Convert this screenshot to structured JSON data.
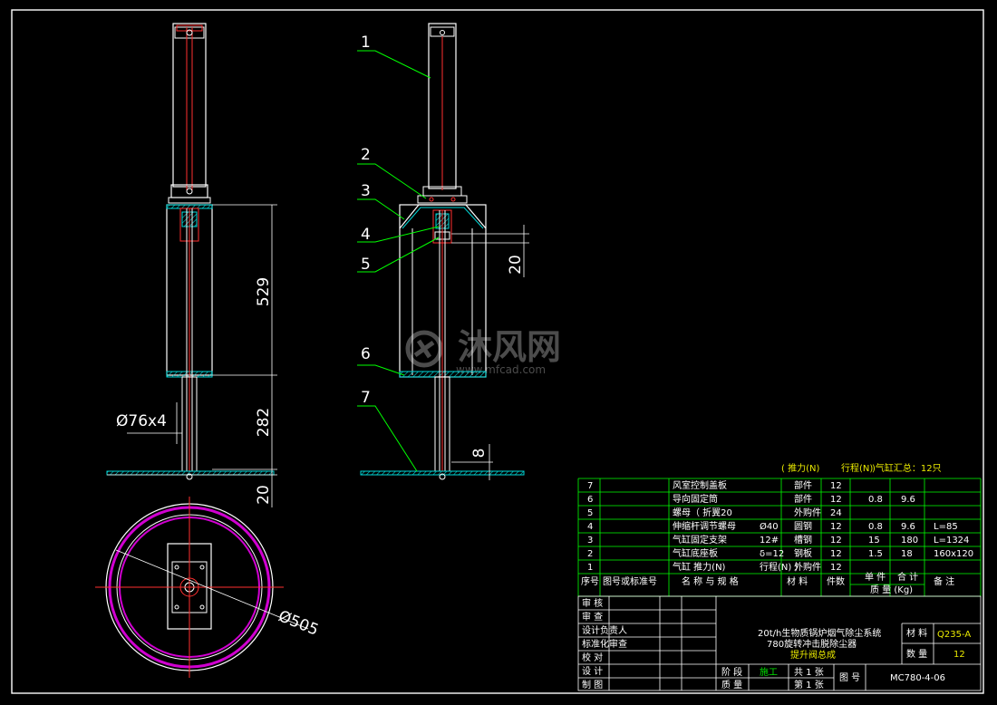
{
  "colors": {
    "background": "#000000",
    "outline": "#ffffff",
    "section": "#ff3030",
    "leader": "#00ff00",
    "hatch": "#00d8d8",
    "ring": "#d000d0",
    "table_grid": "#00ff00"
  },
  "labels": {
    "l1": "1",
    "l2": "2",
    "l3": "3",
    "l4": "4",
    "l5": "5",
    "l6": "6",
    "l7": "7"
  },
  "dims": {
    "d529": "529",
    "d282": "282",
    "d20a": "20",
    "d20b": "20",
    "d8": "8",
    "d76": "Ø76x4",
    "d505": "Ø505"
  },
  "watermark": {
    "brand": "沐风网",
    "url": "www.mfcad.com"
  },
  "table_note": {
    "a": "( 推力(N)",
    "b": "行程(N)",
    "c": ")气缸汇总：12只"
  },
  "bom": [
    {
      "no": "7",
      "code": "",
      "name": "风室控制盖板",
      "spec": "",
      "material": "部件",
      "qty": "12",
      "unit": "",
      "total": "",
      "note": ""
    },
    {
      "no": "6",
      "code": "",
      "name": "导向固定筒",
      "spec": "",
      "material": "部件",
      "qty": "12",
      "unit": "0.8",
      "total": "9.6",
      "note": ""
    },
    {
      "no": "5",
      "code": "",
      "name": "螺母（ 折翼20",
      "spec": "",
      "material": "外购件",
      "qty": "24",
      "unit": "",
      "total": "",
      "note": ""
    },
    {
      "no": "4",
      "code": "",
      "name": "伸缩杆调节螺母",
      "spec": "Ø40",
      "material": "圆钢",
      "qty": "12",
      "unit": "0.8",
      "total": "9.6",
      "note": "L=85"
    },
    {
      "no": "3",
      "code": "",
      "name": "气缸固定支架",
      "spec": "12#",
      "material": "槽钢",
      "qty": "12",
      "unit": "15",
      "total": "180",
      "note": "L=1324"
    },
    {
      "no": "2",
      "code": "",
      "name": "气缸底座板",
      "spec": "δ=12",
      "material": "钢板",
      "qty": "12",
      "unit": "1.5",
      "total": "18",
      "note": "160x120"
    },
    {
      "no": "1",
      "code": "",
      "name": "气缸 推力(N)",
      "spec": "行程(N)   )",
      "material": "外购件",
      "qty": "12",
      "unit": "",
      "total": "",
      "note": ""
    }
  ],
  "bom_header": {
    "no": "序号",
    "code": "图号或标准号",
    "name": "名 称 与 规 格",
    "material": "材 料",
    "qty": "件数",
    "unit": "单 件",
    "total": "合 计",
    "mass": "质 量 (Kg)",
    "note": "备 注"
  },
  "title_block": {
    "roles": [
      "审    核",
      "审    查",
      "设计负责人",
      "标准化审查",
      "校    对",
      "设    计",
      "制    图"
    ],
    "project_line1": "20t/h生物质锅炉烟气除尘系统",
    "project_line2": "780旋转冲击脱除尘器",
    "drawing_name": "提升阀总成",
    "material_label": "材 料",
    "material_value": "Q235-A",
    "quantity_label": "数 量",
    "quantity_value": "12",
    "stage_label": "阶 段",
    "stage_value": "施工",
    "mass_label": "质 量",
    "sheets_total": "共 1 张",
    "sheet_no": "第 1 张",
    "drawing_no_label": "图 号",
    "drawing_no": "MC780-4-06"
  }
}
